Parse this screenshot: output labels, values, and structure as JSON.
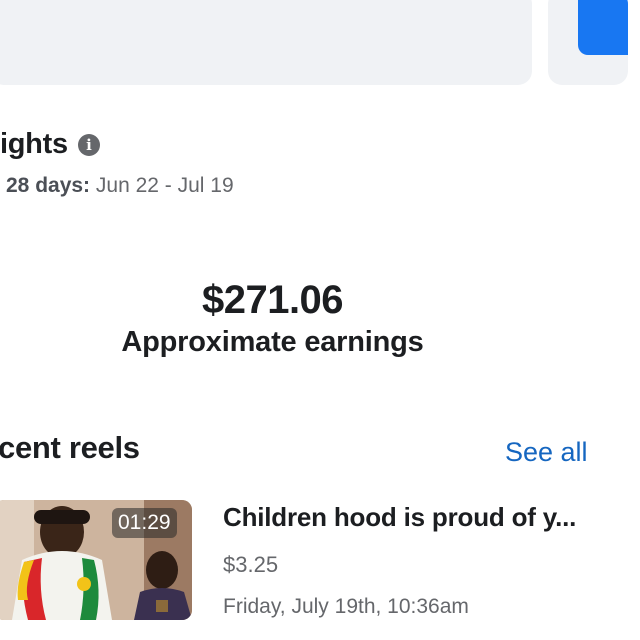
{
  "insights": {
    "title": "ights",
    "range_prefix": "28 days:",
    "range_value": " Jun 22 - Jul 19"
  },
  "earnings": {
    "value": "$271.06",
    "label": "Approximate earnings"
  },
  "recent_reels": {
    "title": "cent reels",
    "see_all_label": "See all",
    "items": [
      {
        "duration": "01:29",
        "title": "Children hood is proud of y...",
        "earnings": "$3.25",
        "date": "Friday, July 19th, 10:36am"
      }
    ]
  },
  "colors": {
    "accent": "#1877f2",
    "link": "#1566c0",
    "card_bg": "#f0f2f5",
    "secondary_text": "#65676b"
  },
  "icons": {
    "info": "info-icon"
  }
}
